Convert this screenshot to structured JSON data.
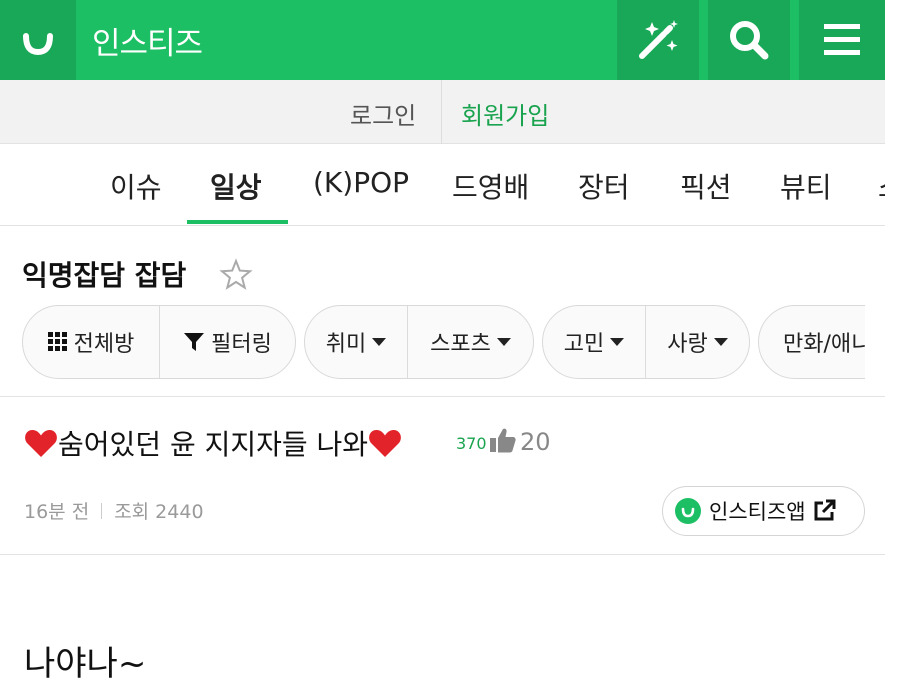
{
  "header": {
    "site_name": "인스티즈",
    "icons": [
      "logo-icon",
      "magic-wand-icon",
      "search-icon",
      "menu-icon"
    ],
    "colors": {
      "brand_green": "#1dbf64",
      "brand_green_dark": "#18a857"
    }
  },
  "auth": {
    "login_label": "로그인",
    "signup_label": "회원가입"
  },
  "categories": [
    {
      "label": "이슈",
      "active": false
    },
    {
      "label": "일상",
      "active": true
    },
    {
      "label": "(K)POP",
      "active": false
    },
    {
      "label": "드영배",
      "active": false
    },
    {
      "label": "장터",
      "active": false
    },
    {
      "label": "픽션",
      "active": false
    },
    {
      "label": "뷰티",
      "active": false
    },
    {
      "label": "소",
      "active": false
    }
  ],
  "board": {
    "title": "익명잡담 잡담",
    "favorite_icon": "star-outline-icon",
    "filters": [
      {
        "segments": [
          {
            "label": "전체방",
            "icon": "grid-icon"
          },
          {
            "label": "필터링",
            "icon": "funnel-icon"
          }
        ]
      },
      {
        "segments": [
          {
            "label": "취미",
            "dropdown": true
          },
          {
            "label": "스포츠",
            "dropdown": true
          }
        ]
      },
      {
        "segments": [
          {
            "label": "고민",
            "dropdown": true
          },
          {
            "label": "사랑",
            "dropdown": true
          }
        ]
      },
      {
        "segments": [
          {
            "label": "만화/애니"
          }
        ]
      }
    ]
  },
  "post": {
    "title_text": "숨어있던 윤 지지자들 나와",
    "title_decoration_icon": "heart-icon",
    "comment_count": "370",
    "like_icon": "thumbs-up-icon",
    "like_count": "20",
    "time_ago": "16분 전",
    "views": "조회 2440",
    "app_button_label": "인스티즈앱",
    "app_button_icon": "external-link-icon",
    "body": "나야나~"
  }
}
